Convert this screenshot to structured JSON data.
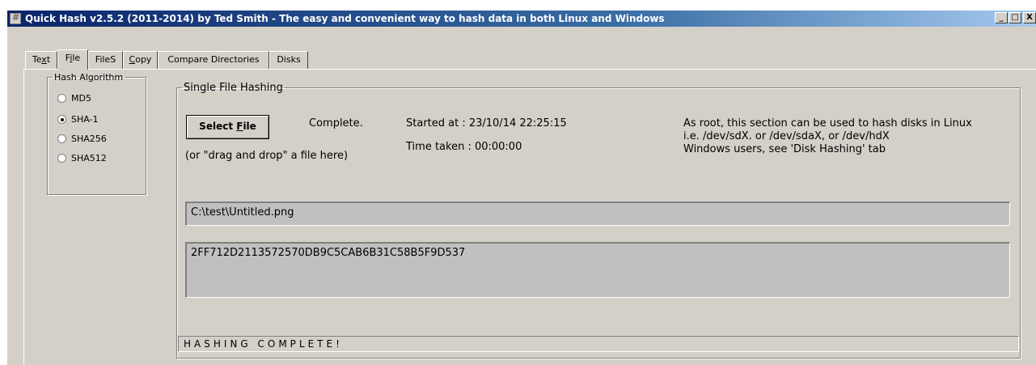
{
  "window": {
    "title": "Quick Hash v2.5.2 (2011-2014) by Ted Smith - The easy and convenient way to hash data in both Linux and Windows",
    "controls": {
      "minimize": "_",
      "maximize": "□",
      "close": "X"
    }
  },
  "tabs": [
    {
      "label": "Text",
      "accel": "x",
      "active": false
    },
    {
      "label": "File",
      "accel": "i",
      "active": true
    },
    {
      "label": "FileS",
      "accel": "",
      "active": false
    },
    {
      "label": "Copy",
      "accel": "C",
      "active": false
    },
    {
      "label": "Compare Directories",
      "accel": "",
      "active": false
    },
    {
      "label": "Disks",
      "accel": "",
      "active": false
    }
  ],
  "hash_algorithm": {
    "title": "Hash Algorithm",
    "options": [
      {
        "label": "MD5",
        "selected": false
      },
      {
        "label": "SHA-1",
        "selected": true
      },
      {
        "label": "SHA256",
        "selected": false
      },
      {
        "label": "SHA512",
        "selected": false
      }
    ]
  },
  "single_file": {
    "title": "Single File Hashing",
    "select_button": "Select File",
    "drag_hint": "(or \"drag and drop\" a file here)",
    "status_text": "Complete.",
    "started_at": "Started at  : 23/10/14 22:25:15",
    "time_taken": "Time taken : 00:00:00",
    "info_line1": "As root, this section can be used to hash disks in Linux",
    "info_line2": "i.e. /dev/sdX. or /dev/sdaX, or /dev/hdX",
    "info_line3": "Windows users, see 'Disk Hashing' tab",
    "file_path": "C:\\test\\Untitled.png",
    "hash_value": "2FF712D2113572570DB9C5CAB6B31C58B5F9D537",
    "status_bar": "HASHING COMPLETE!"
  }
}
